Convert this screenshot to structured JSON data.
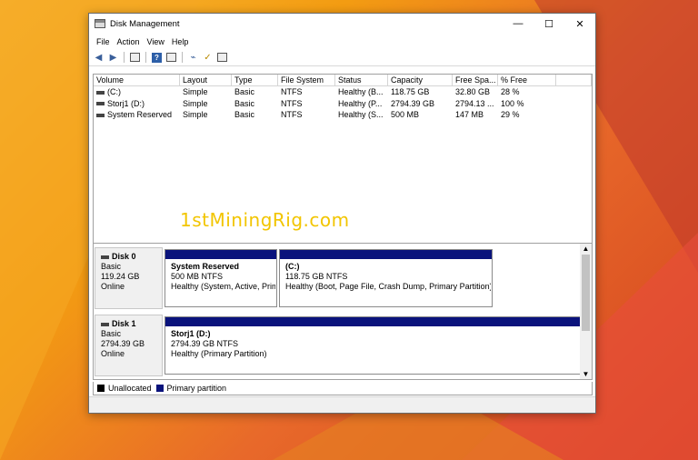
{
  "window": {
    "title": "Disk Management",
    "controls": {
      "minimize": "—",
      "maximize": "☐",
      "close": "✕"
    }
  },
  "menu": [
    "File",
    "Action",
    "View",
    "Help"
  ],
  "toolbar": [
    "back-arrow-icon",
    "forward-arrow-icon",
    "properties-icon",
    "help-icon",
    "show-hide-icon",
    "rescan-icon",
    "check-icon",
    "console-icon"
  ],
  "volume_list": {
    "columns": [
      "Volume",
      "Layout",
      "Type",
      "File System",
      "Status",
      "Capacity",
      "Free Spa...",
      "% Free",
      ""
    ],
    "rows": [
      [
        "(C:)",
        "Simple",
        "Basic",
        "NTFS",
        "Healthy (B...",
        "118.75 GB",
        "32.80 GB",
        "28 %"
      ],
      [
        "Storj1 (D:)",
        "Simple",
        "Basic",
        "NTFS",
        "Healthy (P...",
        "2794.39 GB",
        "2794.13 ...",
        "100 %"
      ],
      [
        "System Reserved",
        "Simple",
        "Basic",
        "NTFS",
        "Healthy (S...",
        "500 MB",
        "147 MB",
        "29 %"
      ]
    ]
  },
  "watermark": "1stMiningRig.com",
  "disks": [
    {
      "name": "Disk 0",
      "type": "Basic",
      "size": "119.24 GB",
      "state": "Online",
      "partitions": [
        {
          "name": "System Reserved",
          "size": "500 MB NTFS",
          "status": "Healthy (System, Active, Prim"
        },
        {
          "name": "(C:)",
          "size": "118.75 GB NTFS",
          "status": "Healthy (Boot, Page File, Crash Dump, Primary Partition)"
        }
      ]
    },
    {
      "name": "Disk 1",
      "type": "Basic",
      "size": "2794.39 GB",
      "state": "Online",
      "partitions": [
        {
          "name": "Storj1  (D:)",
          "size": "2794.39 GB NTFS",
          "status": "Healthy (Primary Partition)"
        }
      ]
    }
  ],
  "legend": [
    {
      "label": "Unallocated",
      "color": "#000000"
    },
    {
      "label": "Primary partition",
      "color": "#0a137c"
    }
  ]
}
